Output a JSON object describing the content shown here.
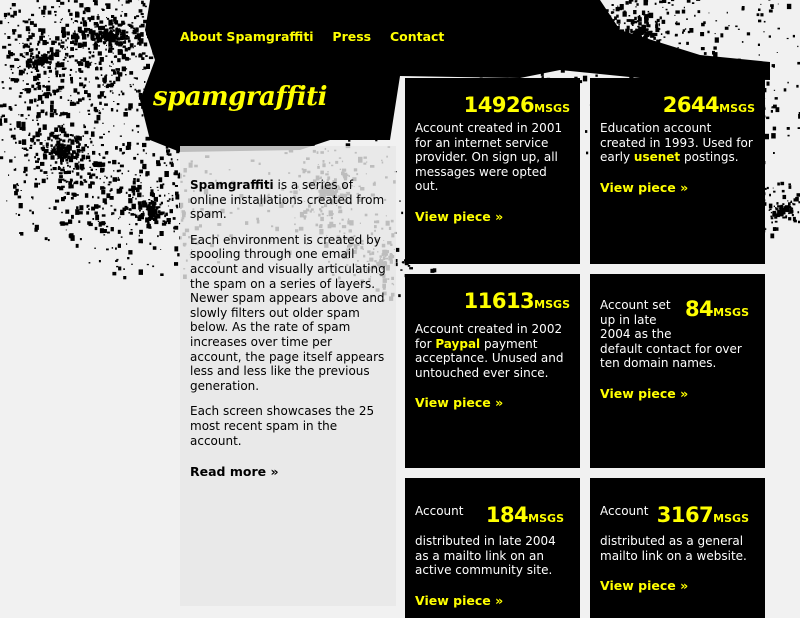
{
  "nav": {
    "items": [
      "About Spamgraffiti",
      "Press",
      "Contact"
    ]
  },
  "logo": {
    "text": "spamgraffiti"
  },
  "intro": {
    "name": "Spamgraffiti",
    "p1_rest": " is a series of online installations created from spam.",
    "p2": "Each environment is created by spooling through one email account and visually articulating the spam on a series of layers. Newer spam appears above and slowly filters out older spam below. As the rate of spam increases over time per account, the page itself appears less and less like the previous generation.",
    "p3": "Each screen showcases the 25 most recent spam in the account.",
    "read_more": "Read more »"
  },
  "cards": [
    {
      "count": "14926",
      "unit": "MSGS",
      "text_a": "Account created in 2001 for an internet service provider. On sign up, all messages were opted out.",
      "highlight": "",
      "text_b": "",
      "view": "View piece »"
    },
    {
      "count": "2644",
      "unit": "MSGS",
      "text_a": "Education account created in 1993. Used for early ",
      "highlight": "usenet",
      "text_b": " postings.",
      "view": "View piece »"
    },
    {
      "count": "11613",
      "unit": "MSGS",
      "text_a": "Account created in 2002 for ",
      "highlight": "Paypal",
      "text_b": " payment acceptance. Unused and untouched ever since.",
      "view": "View piece »"
    },
    {
      "count": "84",
      "unit": "MSGS",
      "text_a": "Account set up in late 2004 as the default contact for over ten domain names.",
      "highlight": "",
      "text_b": "",
      "view": "View piece »"
    },
    {
      "count": "184",
      "unit": "MSGS",
      "text_a": "Account distributed in late 2004 as a mailto link on an active community site.",
      "highlight": "",
      "text_b": "",
      "view": "View piece »"
    },
    {
      "count": "3167",
      "unit": "MSGS",
      "text_a": "Account distributed as a general mailto link on a website.",
      "highlight": "",
      "text_b": "",
      "view": "View piece »"
    }
  ],
  "colors": {
    "accent": "#ffff00",
    "card_bg": "#000000",
    "page_bg": "#f1f1f1"
  }
}
